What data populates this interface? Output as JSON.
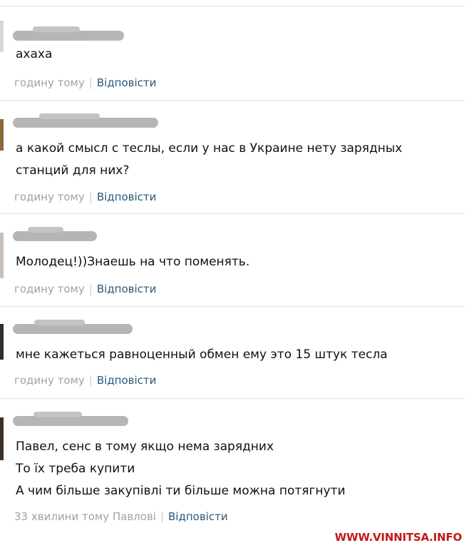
{
  "comments": [
    {
      "text_lines": [
        "ахаха"
      ],
      "time": "годину тому",
      "reply_label": "Відповісти"
    },
    {
      "text_lines": [
        "а какой смысл с теслы, если у нас в Украине нету зарядных",
        "станций для них?"
      ],
      "time": "годину тому",
      "reply_label": "Відповісти"
    },
    {
      "text_lines": [
        "Молодец!))Знаешь на что поменять."
      ],
      "time": "годину тому",
      "reply_label": "Відповісти"
    },
    {
      "text_lines": [
        "мне кажеться равноценный обмен ему это 15 штук тесла"
      ],
      "time": "годину тому",
      "reply_label": "Відповісти"
    },
    {
      "text_lines": [
        "Павел, сенс в тому якщо нема зарядних",
        "То їх треба купити",
        "А чим більше закупівлі ти більше можна потягнути"
      ],
      "time": "33 хвилини тому Павлові",
      "reply_label": "Відповісти"
    }
  ],
  "watermark": "WWW.VINNITSA.INFO",
  "colors": {
    "text": "#111111",
    "meta": "#9aa3ad",
    "link": "#2b587a",
    "divider": "#dfe3e8",
    "watermark": "#c41818"
  }
}
